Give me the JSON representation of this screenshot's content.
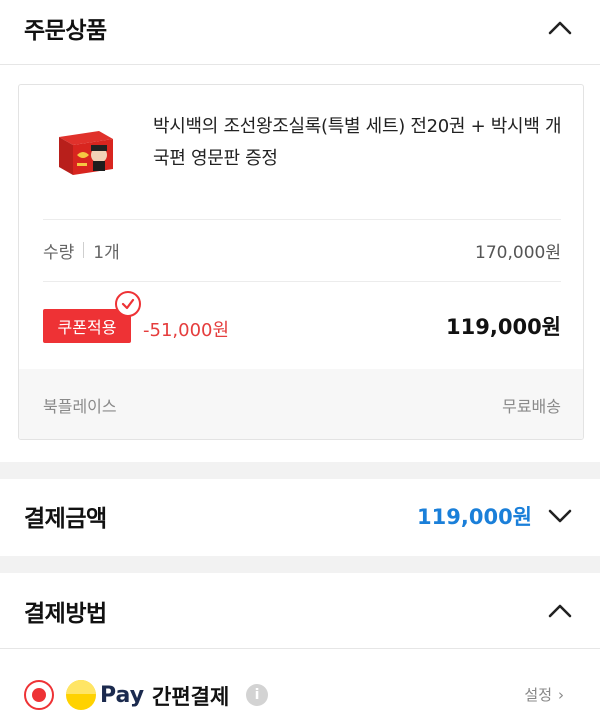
{
  "order_section": {
    "title": "주문상품",
    "product": {
      "name": "박시백의 조선왕조실록(특별 세트) 전20권 + 박시백 개국편 영문판 증정",
      "quantity_label": "수량",
      "quantity_value": "1개",
      "original_price": "170,000원",
      "coupon_label": "쿠폰적용",
      "discount": "-51,000원",
      "final_price": "119,000원",
      "seller": "북플레이스",
      "shipping": "무료배송"
    }
  },
  "payment_amount": {
    "title": "결제금액",
    "value": "119,000원"
  },
  "payment_method": {
    "title": "결제방법",
    "option": {
      "logo_text": "Pay",
      "label": "간편결제",
      "info": "i",
      "settings_label": "설정",
      "settings_chevron": "›"
    }
  },
  "icons": {
    "collapse": "chevron-up-icon",
    "expand": "chevron-down-icon",
    "coupon_check": "check-icon",
    "info": "info-icon"
  },
  "colors": {
    "accent_red": "#ee3235",
    "price_blue": "#1a7fd9",
    "pay_yellow": "#ffd200",
    "pay_navy": "#1b2a4e"
  }
}
